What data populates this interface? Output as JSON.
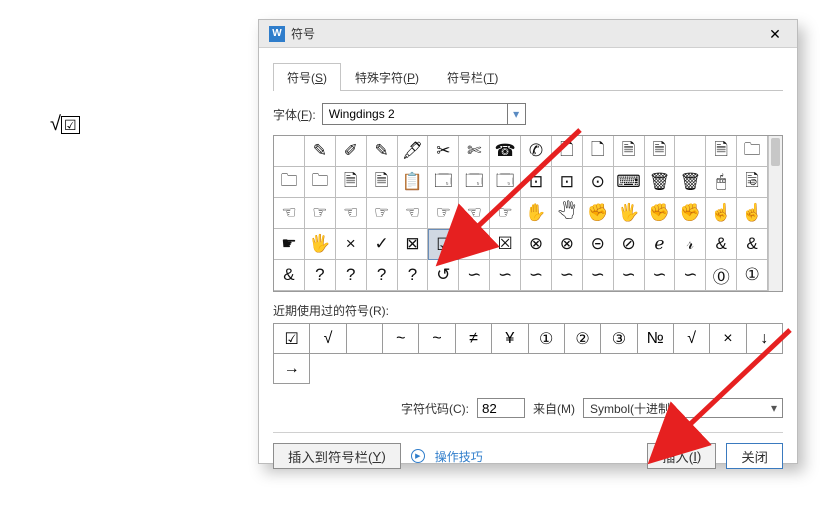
{
  "doc": {
    "sample_sqrt": "√",
    "sample_box": "☑"
  },
  "dialog": {
    "app_glyph": "W",
    "title": "符号",
    "close": "✕",
    "tabs": [
      {
        "pre": "符号(",
        "u": "S",
        "post": ")"
      },
      {
        "pre": "特殊字符(",
        "u": "P",
        "post": ")"
      },
      {
        "pre": "符号栏(",
        "u": "T",
        "post": ")"
      }
    ],
    "font_label_pre": "字体(",
    "font_label_u": "F",
    "font_label_post": "):",
    "font_value": "Wingdings 2",
    "grid": [
      " ",
      "✎",
      "✐",
      "✎",
      "🖋",
      "✂",
      "✄",
      "☎",
      "✆",
      "🗋",
      "🗋",
      "🗎",
      "🗎",
      "",
      "🗎",
      "🗀",
      "🗀",
      "🗀",
      "🗎",
      "🗎",
      "📋",
      "🗔",
      "🗔",
      "🗔",
      "⊡",
      "⊡",
      "⊙",
      "⌨",
      "🗑",
      "🗑",
      "🖱",
      "🗟",
      "☜",
      "☞",
      "☜",
      "☞",
      "☜",
      "☞",
      "☜",
      "☞",
      "✋",
      "🖑",
      "✊",
      "🖐",
      "✊",
      "✊",
      "☝",
      "☝",
      "☛",
      "🖐",
      "×",
      "✓",
      "⊠",
      "☑",
      "☒",
      "☒",
      "⊗",
      "⊗",
      "⊝",
      "⊘",
      "ℯ",
      "𝓇",
      "&",
      "&",
      "&",
      "?",
      "?",
      "?",
      "?",
      "↺",
      "∽",
      "∽",
      "∽",
      "∽",
      "∽",
      "∽",
      "∽",
      "∽",
      "⓪",
      "①"
    ],
    "selected_index": 53,
    "recent_label_pre": "近期使用过的符号(",
    "recent_label_u": "R",
    "recent_label_post": "):",
    "recent": [
      "☑",
      "√",
      " ",
      "~",
      "~",
      "≠",
      "¥",
      "①",
      "②",
      "③",
      "№",
      "√",
      "×",
      "↓",
      "→"
    ],
    "code_label_pre": "字符代码(",
    "code_label_u": "C",
    "code_label_post": "):",
    "code_value": "82",
    "from_label_pre": "来自(",
    "from_label_u": "M",
    "from_label_post": ")",
    "from_value": "Symbol(十进制)",
    "insert_toolbar_pre": "插入到符号栏(",
    "insert_toolbar_u": "Y",
    "insert_toolbar_post": ")",
    "tips_label": "操作技巧",
    "insert_pre": "插入(",
    "insert_u": "I",
    "insert_post": ")",
    "close_label": "关闭"
  }
}
